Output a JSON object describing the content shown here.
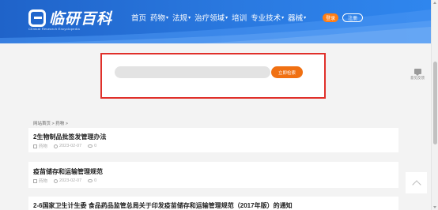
{
  "header": {
    "logo_text": "临研百科",
    "logo_sub": "Clinical Research Encyclopedia",
    "nav": [
      {
        "label": "首页",
        "dropdown": false
      },
      {
        "label": "药物",
        "dropdown": true
      },
      {
        "label": "法规",
        "dropdown": true
      },
      {
        "label": "治疗领域",
        "dropdown": true
      },
      {
        "label": "培训",
        "dropdown": false
      },
      {
        "label": "专业技术",
        "dropdown": true
      },
      {
        "label": "器械",
        "dropdown": true
      }
    ],
    "login_label": "登录",
    "register_label": "注册"
  },
  "search": {
    "placeholder": "",
    "button_label": "立即检索"
  },
  "feedback": {
    "label": "意见反馈"
  },
  "breadcrumb": "网站首页 > 药物 >",
  "articles": [
    {
      "title": "2生物制品批签发管理办法",
      "category": "药物",
      "date": "2023-02-07",
      "views": "0"
    },
    {
      "title": "疫苗储存和运输管理规范",
      "category": "药物",
      "date": "2023-02-07",
      "views": "0"
    },
    {
      "title": "2-6国家卫生计生委 食品药品监管总局关于印发疫苗储存和运输管理规范（2017年版）的通知",
      "category": "",
      "date": "",
      "views": ""
    }
  ],
  "colors": {
    "header": "#2a79e0",
    "accent": "#f07012",
    "highlight_border": "#e0302a"
  }
}
